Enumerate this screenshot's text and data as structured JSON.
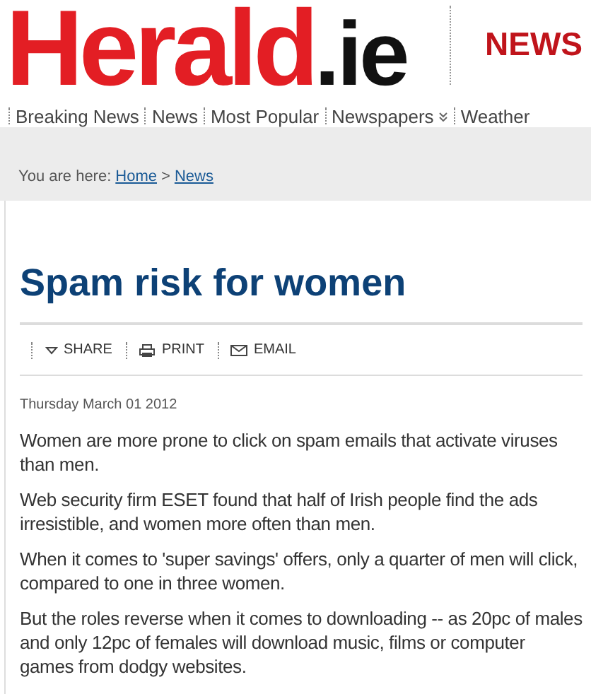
{
  "logo": {
    "name": "Herald",
    "suffix": ".ie"
  },
  "section": "NEWS",
  "nav": [
    {
      "label": "Breaking News",
      "kind": "link"
    },
    {
      "label": "News",
      "kind": "link"
    },
    {
      "label": "Most Popular",
      "kind": "link"
    },
    {
      "label": "Newspapers",
      "kind": "menu"
    },
    {
      "label": "Weather",
      "kind": "link"
    }
  ],
  "breadcrumb": {
    "prefix": "You are here:",
    "links": [
      "Home",
      "News"
    ],
    "separator": ">"
  },
  "article": {
    "title": "Spam risk for women",
    "actions": [
      {
        "label": "SHARE",
        "kind": "share"
      },
      {
        "label": "PRINT",
        "kind": "print"
      },
      {
        "label": "EMAIL",
        "kind": "email"
      }
    ],
    "date": "Thursday March 01 2012",
    "paragraphs": [
      "Women are more prone to click on spam emails that activate viruses than men.",
      "Web security firm ESET found that half of Irish people find the ads irresistible, and women more often than men.",
      "When it comes to 'super savings' offers, only a quarter of men will click, compared to one in three women.",
      "But the roles reverse when it comes to downloading -- as 20pc of males and only 12pc of females will download music, films or computer games from dodgy websites."
    ]
  }
}
